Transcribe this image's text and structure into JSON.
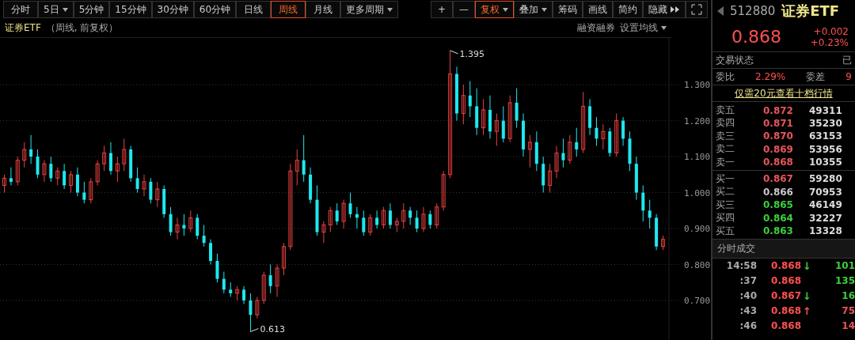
{
  "toolbar": {
    "periods": [
      {
        "label": "分时",
        "selected": false,
        "has_menu": false
      },
      {
        "label": "5日",
        "selected": false,
        "has_menu": true
      },
      {
        "label": "5分钟",
        "selected": false,
        "has_menu": false
      },
      {
        "label": "15分钟",
        "selected": false,
        "has_menu": false
      },
      {
        "label": "30分钟",
        "selected": false,
        "has_menu": false
      },
      {
        "label": "60分钟",
        "selected": false,
        "has_menu": false
      },
      {
        "label": "日线",
        "selected": false,
        "has_menu": false
      },
      {
        "label": "周线",
        "selected": true,
        "has_menu": false
      },
      {
        "label": "月线",
        "selected": false,
        "has_menu": false
      },
      {
        "label": "更多周期",
        "selected": false,
        "has_menu": true
      }
    ],
    "tools": [
      {
        "kind": "text",
        "label": "+",
        "selected": false,
        "has_menu": false
      },
      {
        "kind": "text",
        "label": "—",
        "selected": false,
        "has_menu": false
      },
      {
        "kind": "text",
        "label": "复权",
        "selected": true,
        "has_menu": true
      },
      {
        "kind": "text",
        "label": "叠加",
        "selected": false,
        "has_menu": true
      },
      {
        "kind": "text",
        "label": "筹码",
        "selected": false,
        "has_menu": false
      },
      {
        "kind": "text",
        "label": "画线",
        "selected": false,
        "has_menu": false
      },
      {
        "kind": "text",
        "label": "简约",
        "selected": false,
        "has_menu": false
      },
      {
        "kind": "more",
        "label": "隐藏",
        "selected": false,
        "has_menu": false
      },
      {
        "kind": "fullscreen",
        "selected": false,
        "has_menu": false
      }
    ]
  },
  "chart": {
    "name": "证券ETF",
    "subtitle": "（周线, 前复权）",
    "links": [
      {
        "label": "融资融券",
        "has_menu": false
      },
      {
        "label": "设置均线",
        "has_menu": true
      }
    ],
    "chart_data": {
      "type": "candlestick",
      "grid": true,
      "ohlc": [
        [
          1.02,
          1.05,
          1.0,
          1.04
        ],
        [
          1.04,
          1.07,
          1.02,
          1.03
        ],
        [
          1.03,
          1.1,
          1.02,
          1.09
        ],
        [
          1.09,
          1.14,
          1.07,
          1.12
        ],
        [
          1.12,
          1.16,
          1.08,
          1.1
        ],
        [
          1.1,
          1.12,
          1.04,
          1.05
        ],
        [
          1.05,
          1.09,
          1.03,
          1.08
        ],
        [
          1.08,
          1.1,
          1.03,
          1.04
        ],
        [
          1.04,
          1.07,
          1.02,
          1.06
        ],
        [
          1.06,
          1.08,
          1.01,
          1.02
        ],
        [
          1.02,
          1.06,
          1.0,
          1.05
        ],
        [
          1.05,
          1.07,
          0.99,
          1.0
        ],
        [
          1.0,
          1.03,
          0.97,
          0.98
        ],
        [
          0.98,
          1.04,
          0.97,
          1.03
        ],
        [
          1.03,
          1.09,
          1.02,
          1.08
        ],
        [
          1.08,
          1.13,
          1.06,
          1.11
        ],
        [
          1.11,
          1.14,
          1.05,
          1.06
        ],
        [
          1.06,
          1.1,
          1.03,
          1.08
        ],
        [
          1.08,
          1.15,
          1.06,
          1.12
        ],
        [
          1.12,
          1.13,
          1.03,
          1.04
        ],
        [
          1.04,
          1.07,
          1.0,
          1.01
        ],
        [
          1.01,
          1.05,
          0.99,
          1.03
        ],
        [
          1.03,
          1.04,
          0.97,
          0.98
        ],
        [
          0.98,
          1.03,
          0.96,
          1.01
        ],
        [
          1.01,
          1.02,
          0.93,
          0.94
        ],
        [
          0.94,
          0.96,
          0.88,
          0.89
        ],
        [
          0.89,
          0.93,
          0.87,
          0.91
        ],
        [
          0.91,
          0.94,
          0.88,
          0.9
        ],
        [
          0.9,
          0.95,
          0.89,
          0.93
        ],
        [
          0.93,
          0.94,
          0.87,
          0.88
        ],
        [
          0.88,
          0.91,
          0.85,
          0.86
        ],
        [
          0.86,
          0.87,
          0.8,
          0.81
        ],
        [
          0.81,
          0.83,
          0.75,
          0.76
        ],
        [
          0.76,
          0.78,
          0.72,
          0.73
        ],
        [
          0.73,
          0.75,
          0.71,
          0.72
        ],
        [
          0.72,
          0.74,
          0.7,
          0.73
        ],
        [
          0.73,
          0.74,
          0.69,
          0.7
        ],
        [
          0.7,
          0.72,
          0.613,
          0.66
        ],
        [
          0.66,
          0.71,
          0.65,
          0.7
        ],
        [
          0.7,
          0.78,
          0.69,
          0.77
        ],
        [
          0.77,
          0.8,
          0.72,
          0.74
        ],
        [
          0.74,
          0.8,
          0.71,
          0.79
        ],
        [
          0.79,
          0.86,
          0.77,
          0.85
        ],
        [
          0.85,
          1.08,
          0.84,
          1.06
        ],
        [
          1.06,
          1.12,
          1.02,
          1.09
        ],
        [
          1.09,
          1.16,
          1.03,
          1.05
        ],
        [
          1.05,
          1.07,
          0.97,
          0.98
        ],
        [
          0.98,
          1.02,
          0.88,
          0.89
        ],
        [
          0.89,
          0.92,
          0.86,
          0.91
        ],
        [
          0.91,
          0.96,
          0.89,
          0.95
        ],
        [
          0.95,
          0.97,
          0.91,
          0.92
        ],
        [
          0.92,
          0.98,
          0.9,
          0.97
        ],
        [
          0.97,
          1.0,
          0.93,
          0.94
        ],
        [
          0.94,
          0.96,
          0.9,
          0.93
        ],
        [
          0.93,
          0.95,
          0.88,
          0.89
        ],
        [
          0.89,
          0.94,
          0.88,
          0.93
        ],
        [
          0.93,
          0.95,
          0.9,
          0.91
        ],
        [
          0.91,
          0.96,
          0.9,
          0.95
        ],
        [
          0.95,
          0.97,
          0.9,
          0.91
        ],
        [
          0.91,
          0.93,
          0.89,
          0.92
        ],
        [
          0.92,
          0.97,
          0.9,
          0.95
        ],
        [
          0.95,
          0.96,
          0.91,
          0.93
        ],
        [
          0.93,
          0.95,
          0.89,
          0.9
        ],
        [
          0.9,
          0.96,
          0.89,
          0.94
        ],
        [
          0.94,
          0.95,
          0.9,
          0.91
        ],
        [
          0.91,
          0.97,
          0.9,
          0.96
        ],
        [
          0.96,
          1.06,
          0.95,
          1.05
        ],
        [
          1.05,
          1.395,
          1.04,
          1.33
        ],
        [
          1.33,
          1.35,
          1.2,
          1.22
        ],
        [
          1.22,
          1.3,
          1.19,
          1.27
        ],
        [
          1.27,
          1.31,
          1.21,
          1.24
        ],
        [
          1.24,
          1.29,
          1.16,
          1.18
        ],
        [
          1.18,
          1.26,
          1.16,
          1.23
        ],
        [
          1.23,
          1.27,
          1.15,
          1.17
        ],
        [
          1.17,
          1.22,
          1.13,
          1.2
        ],
        [
          1.2,
          1.24,
          1.14,
          1.15
        ],
        [
          1.15,
          1.27,
          1.14,
          1.25
        ],
        [
          1.25,
          1.29,
          1.18,
          1.2
        ],
        [
          1.2,
          1.22,
          1.1,
          1.12
        ],
        [
          1.12,
          1.16,
          1.07,
          1.14
        ],
        [
          1.14,
          1.17,
          1.06,
          1.08
        ],
        [
          1.08,
          1.1,
          1.0,
          1.02
        ],
        [
          1.02,
          1.08,
          1.0,
          1.06
        ],
        [
          1.06,
          1.13,
          1.04,
          1.11
        ],
        [
          1.11,
          1.15,
          1.07,
          1.09
        ],
        [
          1.09,
          1.16,
          1.08,
          1.14
        ],
        [
          1.14,
          1.18,
          1.1,
          1.12
        ],
        [
          1.12,
          1.28,
          1.11,
          1.24
        ],
        [
          1.24,
          1.26,
          1.16,
          1.18
        ],
        [
          1.18,
          1.21,
          1.13,
          1.15
        ],
        [
          1.15,
          1.19,
          1.12,
          1.17
        ],
        [
          1.17,
          1.18,
          1.1,
          1.11
        ],
        [
          1.11,
          1.22,
          1.1,
          1.2
        ],
        [
          1.2,
          1.21,
          1.13,
          1.15
        ],
        [
          1.15,
          1.17,
          1.06,
          1.08
        ],
        [
          1.08,
          1.1,
          0.98,
          1.0
        ],
        [
          1.0,
          1.02,
          0.92,
          0.95
        ],
        [
          0.95,
          0.98,
          0.9,
          0.93
        ],
        [
          0.93,
          0.94,
          0.84,
          0.85
        ],
        [
          0.85,
          0.88,
          0.84,
          0.87
        ]
      ],
      "ylim": [
        0.59,
        1.43
      ],
      "yticks": [
        {
          "value": 1.3,
          "label": "1.300"
        },
        {
          "value": 1.2,
          "label": "1.200"
        },
        {
          "value": 1.1,
          "label": "1.100"
        },
        {
          "value": 1.0,
          "label": "1.000"
        },
        {
          "value": 0.9,
          "label": "0.900"
        },
        {
          "value": 0.8,
          "label": "0.800"
        },
        {
          "value": 0.7,
          "label": "0.700"
        }
      ],
      "annotations": [
        "1.395",
        "0.613"
      ]
    }
  },
  "quote": {
    "code": "512880",
    "name": "证券ETF",
    "price": "0.868",
    "change": "+0.002",
    "change_pct": "+0.23%",
    "status_label": "交易状态",
    "status_value": "已",
    "ratio_label": "委比",
    "ratio_value": "2.29%",
    "diff_label": "委差",
    "diff_value": "9",
    "promo_link": "仅需20元查看十档行情",
    "asks": [
      {
        "label": "卖五",
        "price": "0.872",
        "volume": "49311",
        "color": "#e8555a"
      },
      {
        "label": "卖四",
        "price": "0.871",
        "volume": "35230",
        "color": "#e8555a"
      },
      {
        "label": "卖三",
        "price": "0.870",
        "volume": "63153",
        "color": "#e8555a"
      },
      {
        "label": "卖二",
        "price": "0.869",
        "volume": "53956",
        "color": "#e8555a"
      },
      {
        "label": "卖一",
        "price": "0.868",
        "volume": "10355",
        "color": "#e8555a"
      }
    ],
    "bids": [
      {
        "label": "买一",
        "price": "0.867",
        "volume": "59280",
        "color": "#e8555a"
      },
      {
        "label": "买二",
        "price": "0.866",
        "volume": "70953",
        "color": "#c8c8c8"
      },
      {
        "label": "买三",
        "price": "0.865",
        "volume": "46149",
        "color": "#3ccf3c"
      },
      {
        "label": "买四",
        "price": "0.864",
        "volume": "32227",
        "color": "#3ccf3c"
      },
      {
        "label": "买五",
        "price": "0.863",
        "volume": "13328",
        "color": "#3ccf3c"
      }
    ]
  },
  "trades": {
    "title": "分时成交",
    "rows": [
      {
        "time": "14:58",
        "price": "0.868",
        "arrow": {
          "text": "↓",
          "color": "#3ccf3c"
        },
        "volume": "101",
        "color": "#3ccf3c"
      },
      {
        "time": ":37",
        "price": "0.868",
        "volume": "135",
        "color": "#3ccf3c"
      },
      {
        "time": ":40",
        "price": "0.867",
        "arrow": {
          "text": "↓",
          "color": "#3ccf3c"
        },
        "volume": "16",
        "color": "#3ccf3c"
      },
      {
        "time": ":43",
        "price": "0.868",
        "arrow": {
          "text": "↑",
          "color": "#e8555a"
        },
        "volume": "75",
        "color": "#e8555a"
      },
      {
        "time": ":46",
        "price": "0.868",
        "volume": "14",
        "color": "#e8555a"
      }
    ]
  }
}
